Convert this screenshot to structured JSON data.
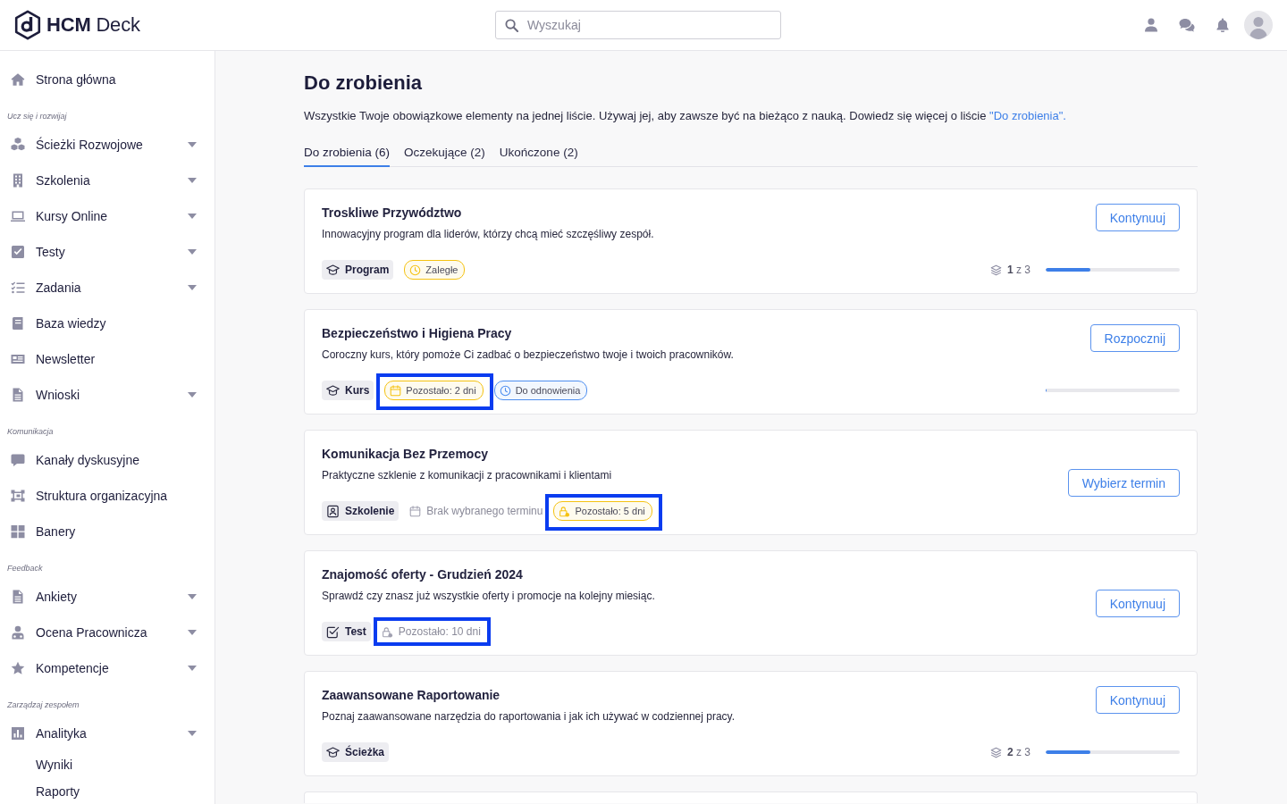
{
  "header": {
    "logo": "**HCM** Deck",
    "search": {
      "placeholder": "Wyszukaj"
    }
  },
  "sidebar": {
    "sections": [
      {
        "items": [
          {
            "label": "Strona główna",
            "submenu": false
          }
        ]
      },
      {
        "heading": "Ucz się i rozwijaj",
        "items": [
          {
            "label": "Ścieżki Rozwojowe",
            "submenu": true
          },
          {
            "label": "Szkolenia",
            "submenu": true
          },
          {
            "label": "Kursy Online",
            "submenu": true
          },
          {
            "label": "Testy",
            "submenu": true
          },
          {
            "label": "Zadania",
            "submenu": true
          },
          {
            "label": "Baza wiedzy",
            "submenu": false
          },
          {
            "label": "Newsletter",
            "submenu": false
          },
          {
            "label": "Wnioski",
            "submenu": true
          }
        ]
      },
      {
        "heading": "Komunikacja",
        "items": [
          {
            "label": "Kanały dyskusyjne",
            "submenu": false
          },
          {
            "label": "Struktura organizacyjna",
            "submenu": false
          },
          {
            "label": "Banery",
            "submenu": false
          }
        ]
      },
      {
        "heading": "Feedback",
        "items": [
          {
            "label": "Ankiety",
            "submenu": true
          },
          {
            "label": "Ocena Pracownicza",
            "submenu": true
          },
          {
            "label": "Kompetencje",
            "submenu": true
          }
        ]
      },
      {
        "heading": "Zarządzaj zespołem",
        "items": [
          {
            "label": "Analityka",
            "submenu": true,
            "children": [
              {
                "label": "Wyniki",
                "submenu": false
              },
              {
                "label": "Raporty",
                "submenu": false
              }
            ]
          }
        ]
      }
    ]
  },
  "page": {
    "title": "Do zrobienia",
    "description": {
      "text": "Wszystkie Twoje obowiązkowe elementy na jednej liście. Używaj jej, aby zawsze być na bieżąco z nauką. Dowiedz się więcej o liście ",
      "link": "\"Do zrobienia\"."
    },
    "tabs": [
      {
        "label": "Do zrobienia (6)",
        "selected": true
      },
      {
        "label": "Oczekujące (2)",
        "selected": false
      },
      {
        "label": "Ukończone (2)",
        "selected": false
      }
    ],
    "cards": [
      {
        "title": "Troskliwe Przywództwo",
        "description": "Innowacyjny program dla liderów, którzy chcą mieć szczęśliwy zespół.",
        "badges": [
          {
            "kind": "program",
            "label": "Program",
            "highlighted": false
          },
          {
            "kind": "overdue",
            "label": "Zaległe",
            "color": "#f5c211",
            "highlighted": false
          }
        ],
        "progress": {
          "label": "**1** z 3",
          "level": 0.33
        },
        "button": "Kontynuuj"
      },
      {
        "title": "Bezpieczeństwo i Higiena Pracy",
        "description": "Coroczny kurs, który pomoże Ci zadbać o bezpieczeństwo twoje i twoich pracowników.",
        "badges": [
          {
            "kind": "course",
            "label": "Kurs",
            "highlighted": false
          },
          {
            "kind": "deadline",
            "label": "Pozostało: 2 dni",
            "color": "#f5c211",
            "highlighted": true
          },
          {
            "kind": "renewal",
            "label": "Do odnowienia",
            "color": "#4d8ef0",
            "highlighted": false
          }
        ],
        "progress": {
          "level": 0
        },
        "button": "Rozpocznij"
      },
      {
        "title": "Komunikacja Bez Przemocy",
        "description": "Praktyczne szklenie z komunikacji z pracownikami i klientami",
        "badges": [
          {
            "kind": "training",
            "label": "Szkolenie",
            "highlighted": false
          },
          {
            "kind": "no-date",
            "label": "Brak wybranego terminu",
            "highlighted": false
          },
          {
            "kind": "locked",
            "label": "Pozostało: 5 dni",
            "color": "#f5c211",
            "highlighted": true
          }
        ],
        "button": "Wybierz termin"
      },
      {
        "title": "Znajomość oferty - Grudzień 2024",
        "description": "Sprawdź czy znasz już wszystkie oferty i promocje na kolejny miesiąc.",
        "badges": [
          {
            "kind": "test",
            "label": "Test",
            "highlighted": false
          },
          {
            "kind": "locked",
            "label": "Pozostało: 10 dni",
            "highlighted": true
          }
        ],
        "button": "Kontynuuj"
      },
      {
        "title": "Zaawansowane Raportowanie",
        "description": "Poznaj zaawansowane narzędzia do raportowania i jak ich używać w codziennej pracy.",
        "badges": [
          {
            "kind": "path",
            "label": "Ścieżka",
            "highlighted": false
          }
        ],
        "progress": {
          "label": "**2** z 3",
          "level": 0.33
        },
        "button": "Kontynuuj"
      }
    ]
  }
}
